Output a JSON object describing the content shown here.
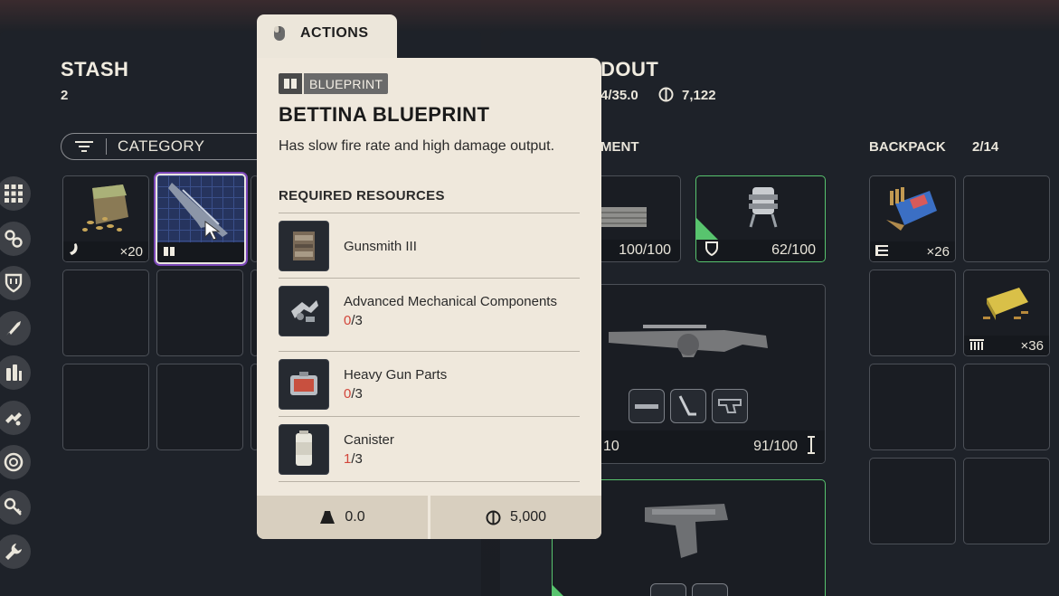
{
  "stash": {
    "title": "STASH",
    "count": "2",
    "filter_label": "CATEGORY",
    "items": [
      {
        "icon": "light-ammo-icon",
        "qty": "×20"
      },
      {
        "icon": "blueprint-icon",
        "qty": ""
      }
    ]
  },
  "sidebar": {
    "icons": [
      "grid-icon",
      "materials-icon",
      "shield-icon",
      "weapon-icon",
      "ammo-icon",
      "mod-icon",
      "augment-icon",
      "key-icon",
      "tools-icon"
    ]
  },
  "loadout": {
    "title_partial": "DOUT",
    "weight_partial": "4/35.0",
    "coins": "7,122",
    "equipment_label_partial": "MENT",
    "backpack_label": "BACKPACK",
    "backpack_count": "2/14",
    "equipment": [
      {
        "value": "100/100"
      },
      {
        "value": "62/100"
      },
      {
        "left_value_partial": "10",
        "value": "91/100"
      }
    ],
    "backpack": [
      {
        "qty": "×26"
      },
      {
        "qty": "×36"
      }
    ]
  },
  "tooltip": {
    "actions_label": "ACTIONS",
    "badge": "BLUEPRINT",
    "title": "BETTINA BLUEPRINT",
    "description": "Has slow fire rate and high damage output.",
    "required_label": "REQUIRED RESOURCES",
    "resources": [
      {
        "name": "Gunsmith III",
        "have": "",
        "need": ""
      },
      {
        "name": "Advanced Mechanical Components",
        "have": "0",
        "need": "/3"
      },
      {
        "name": "Heavy Gun Parts",
        "have": "0",
        "need": "/3"
      },
      {
        "name": "Canister",
        "have": "1",
        "need": "/3"
      }
    ],
    "weight": "0.0",
    "value": "5,000"
  }
}
